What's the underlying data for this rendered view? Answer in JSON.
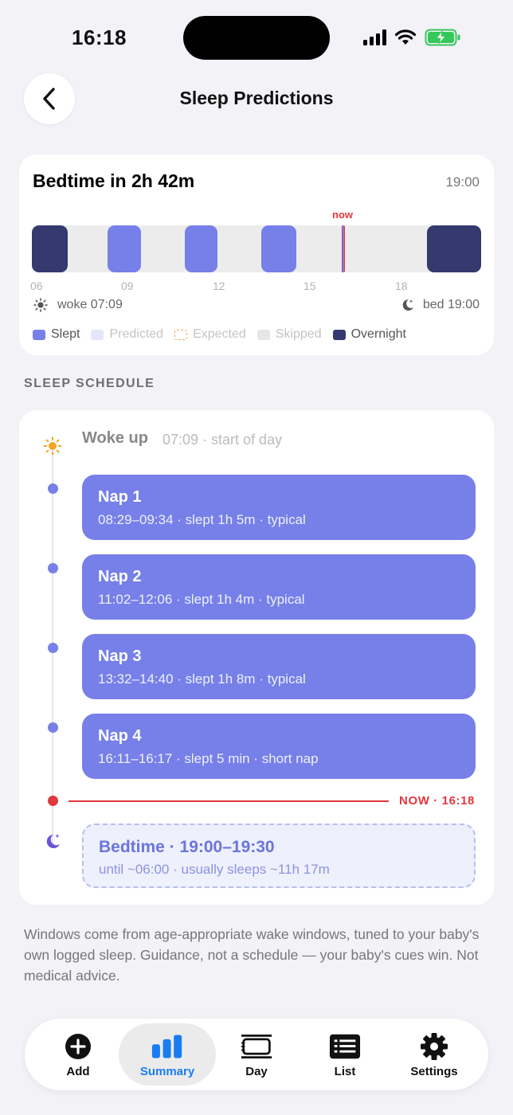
{
  "status_bar": {
    "time": "16:18"
  },
  "header": {
    "title": "Sleep Predictions"
  },
  "bedtime_card": {
    "title": "Bedtime in 2h 42m",
    "bedtime_clock": "19:00",
    "now_label": "now",
    "hour_ticks": [
      "06",
      "09",
      "12",
      "15",
      "18"
    ],
    "woke": "woke 07:09",
    "bed": "bed 19:00",
    "legend": [
      {
        "label": "Slept",
        "color": "#7680e8"
      },
      {
        "label": "Predicted",
        "color": "#e4e7fb"
      },
      {
        "label": "Expected",
        "color": "#f0a35c"
      },
      {
        "label": "Skipped",
        "color": "#e6e6e6"
      },
      {
        "label": "Overnight",
        "color": "#343a6e"
      }
    ]
  },
  "schedule": {
    "section_title": "SLEEP SCHEDULE",
    "woke_title": "Woke up",
    "woke_sub": "07:09 · start of day",
    "naps": [
      {
        "title": "Nap 1",
        "detail": "08:29–09:34 · slept 1h 5m · typical"
      },
      {
        "title": "Nap 2",
        "detail": "11:02–12:06 · slept 1h 4m · typical"
      },
      {
        "title": "Nap 3",
        "detail": "13:32–14:40 · slept 1h 8m · typical"
      },
      {
        "title": "Nap 4",
        "detail": "16:11–16:17 · slept 5 min · short nap"
      }
    ],
    "now_marker": "NOW · 16:18",
    "bedtime_title": "Bedtime · 19:00–19:30",
    "bedtime_sub": "until ~06:00 · usually sleeps ~11h 17m"
  },
  "footnote": "Windows come from age-appropriate wake windows, tuned to your baby's own logged sleep. Guidance, not a schedule — your baby's cues win. Not medical advice.",
  "tabbar": {
    "active_color": "#1a7cf0",
    "tabs": [
      {
        "label": "Add",
        "icon": "plus-circle-icon"
      },
      {
        "label": "Summary",
        "icon": "bar-chart-icon",
        "active": true
      },
      {
        "label": "Day",
        "icon": "day-timeline-icon"
      },
      {
        "label": "List",
        "icon": "list-icon"
      },
      {
        "label": "Settings",
        "icon": "gear-icon"
      }
    ]
  }
}
